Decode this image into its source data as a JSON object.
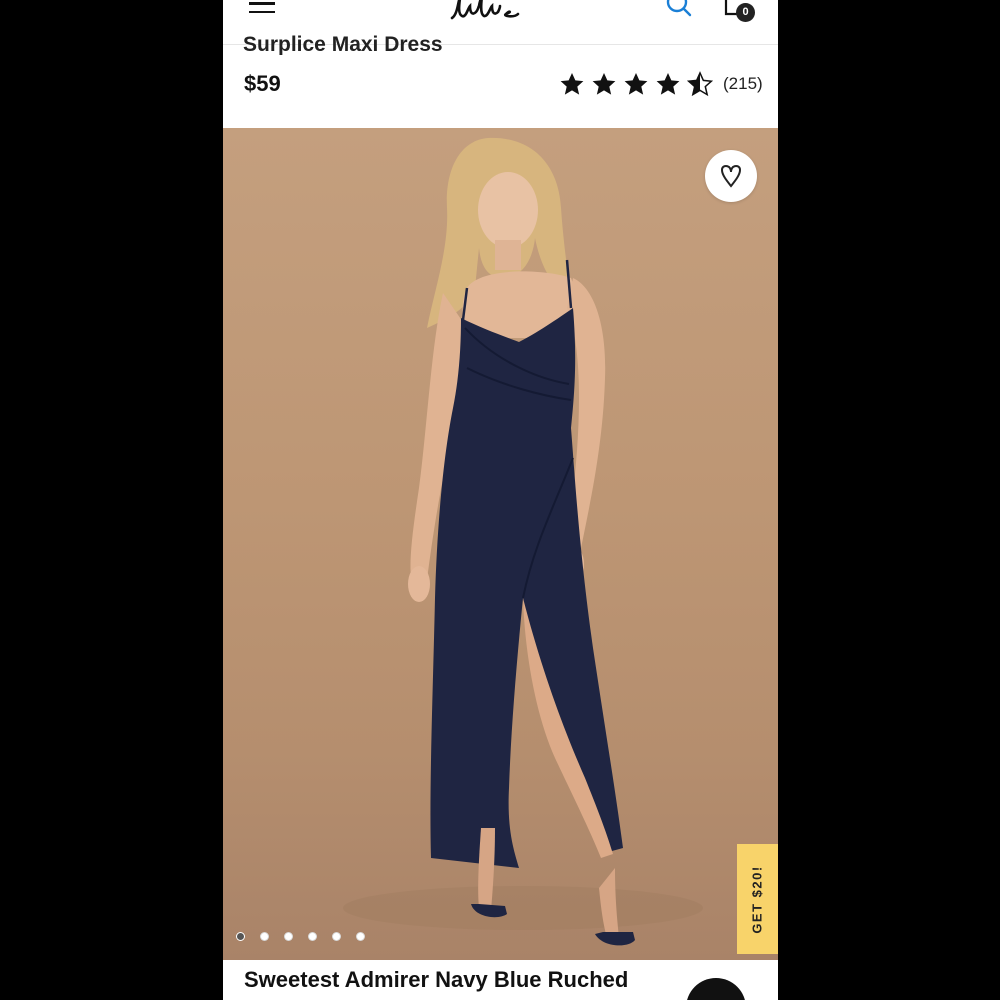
{
  "header": {
    "logo_text": "Lulus",
    "menu_icon": "hamburger-menu-icon",
    "search_icon": "search-icon",
    "cart_icon": "shopping-bag-icon",
    "cart_count": "0"
  },
  "product": {
    "title_partial": "Surplice Maxi Dress",
    "price": "$59",
    "rating": 4.5,
    "rating_max": 5,
    "review_count": "(215)",
    "name": "Sweetest Admirer Navy Blue Ruched"
  },
  "gallery": {
    "image_count": 6,
    "active_index": 0,
    "wishlist_icon": "heart-icon",
    "background_color": "#bf9877",
    "dress_color": "#1f2542"
  },
  "promo": {
    "label": "GET $20!",
    "color": "#f8d36a"
  },
  "chat": {
    "icon": "chat-bubble-icon"
  }
}
